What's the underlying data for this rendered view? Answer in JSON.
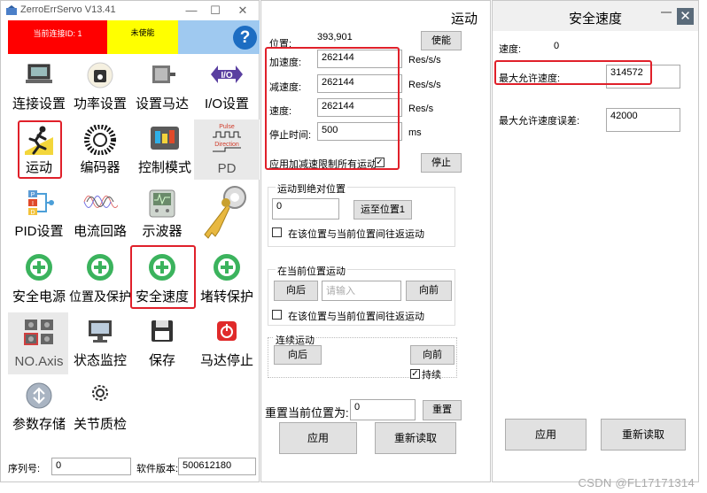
{
  "left": {
    "title": "ZerroErrServo V13.41",
    "status_connection": "当前连接ID: 1",
    "status_enable": "未使能",
    "help": "?",
    "items": [
      {
        "label": "连接设置",
        "icon": "laptop-icon"
      },
      {
        "label": "功率设置",
        "icon": "power-meter-icon"
      },
      {
        "label": "设置马达",
        "icon": "motor-icon"
      },
      {
        "label": "I/O设置",
        "icon": "io-icon",
        "badge": "I/O"
      },
      {
        "label": "运动",
        "icon": "runner-icon"
      },
      {
        "label": "编码器",
        "icon": "encoder-icon"
      },
      {
        "label": "控制模式",
        "icon": "control-mode-icon"
      },
      {
        "label": "PD",
        "icon": "pulse-direction-icon",
        "pulse": "Pulse",
        "direction": "Direction"
      },
      {
        "label": "PID设置",
        "icon": "pid-icon",
        "p": "P",
        "i": "I",
        "d": "D"
      },
      {
        "label": "电流回路",
        "icon": "current-loop-icon"
      },
      {
        "label": "示波器",
        "icon": "oscilloscope-icon"
      },
      {
        "label": "安全电源",
        "icon": "safety-power-icon"
      },
      {
        "label": "位置及保护",
        "icon": "position-protect-icon"
      },
      {
        "label": "安全速度",
        "icon": "safety-speed-icon"
      },
      {
        "label": "堵转保护",
        "icon": "stall-protect-icon"
      },
      {
        "label": "NO.Axis",
        "icon": "axis-icon"
      },
      {
        "label": "状态监控",
        "icon": "monitor-icon"
      },
      {
        "label": "保存",
        "icon": "save-icon"
      },
      {
        "label": "马达停止",
        "icon": "motor-stop-icon"
      },
      {
        "label": "参数存储",
        "icon": "param-store-icon"
      },
      {
        "label": "关节质检",
        "icon": "gear-icon"
      }
    ],
    "serial_label": "序列号:",
    "serial_value": "0",
    "fw_label": "软件版本:",
    "fw_value": "500612180"
  },
  "mid": {
    "title": "运动",
    "position_label": "位置:",
    "position_value": "393,901",
    "enable_btn": "使能",
    "accel_label": "加速度:",
    "accel_value": "262144",
    "accel_unit": "Res/s/s",
    "decel_label": "减速度:",
    "decel_value": "262144",
    "decel_unit": "Res/s/s",
    "speed_label": "速度:",
    "speed_value": "262144",
    "speed_unit": "Res/s",
    "stop_label": "停止时间:",
    "stop_value": "500",
    "stop_unit": "ms",
    "apply_limit_label": "应用加减速限制所有运动",
    "stop_btn": "停止",
    "abs_group_title": "运动到绝对位置",
    "abs_value": "0",
    "abs_btn": "运至位置1",
    "abs_reciprocate": "在该位置与当前位置间往返运动",
    "rel_group_title": "在当前位置运动",
    "rel_back": "向后",
    "rel_placeholder": "请输入",
    "rel_fwd": "向前",
    "rel_reciprocate": "在该位置与当前位置间往返运动",
    "cont_group_title": "连续运动",
    "cont_back": "向后",
    "cont_fwd": "向前",
    "cont_sustain": "持续",
    "reset_label": "重置当前位置为:",
    "reset_value": "0",
    "reset_btn": "重置",
    "apply_btn": "应用",
    "reread_btn": "重新读取"
  },
  "right": {
    "title": "安全速度",
    "speed_label": "速度:",
    "speed_value": "0",
    "max_speed_label": "最大允许速度:",
    "max_speed_value": "314572",
    "max_err_label": "最大允许速度误差:",
    "max_err_value": "42000",
    "apply_btn": "应用",
    "reread_btn": "重新读取"
  },
  "watermark": "CSDN @FL17171314",
  "colors": {
    "highlight_red": "#e0202a",
    "status_red": "#ff0000",
    "status_yellow": "#ffff00",
    "status_blue": "#9fc9f0",
    "safety_green": "#3bb35d"
  }
}
